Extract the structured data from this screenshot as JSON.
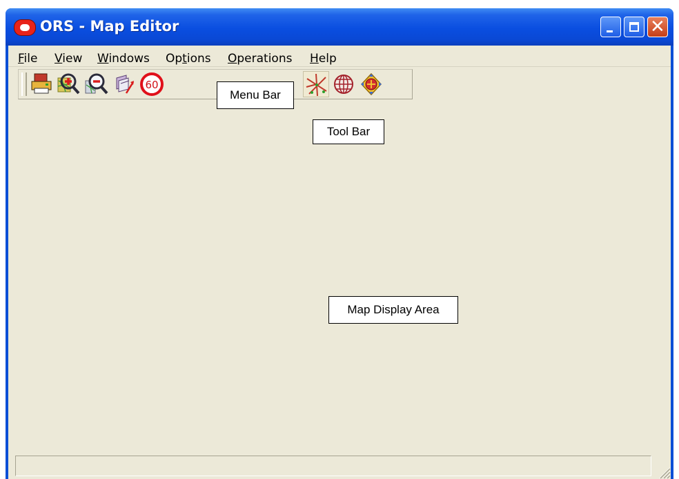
{
  "window": {
    "title": "ORS - Map Editor",
    "title_bar_color": "#0a4ee0",
    "client_color": "#ece9d8"
  },
  "titlebar_controls": [
    {
      "name": "minimize",
      "icon": "minimize-icon"
    },
    {
      "name": "maximize",
      "icon": "maximize-icon"
    },
    {
      "name": "close",
      "icon": "close-icon",
      "glyph": "✕"
    }
  ],
  "menubar": {
    "items": [
      {
        "mnemonic": "F",
        "rest": "ile"
      },
      {
        "mnemonic": "V",
        "rest": "iew"
      },
      {
        "mnemonic": "W",
        "rest": "indows"
      },
      {
        "pre": "Op",
        "mnemonic": "t",
        "rest": "ions"
      },
      {
        "mnemonic": "O",
        "rest": "perations"
      },
      {
        "mnemonic": "H",
        "rest": "elp"
      }
    ]
  },
  "toolbar": {
    "buttons": [
      {
        "icon": "print-icon"
      },
      {
        "icon": "zoom-in-icon"
      },
      {
        "icon": "zoom-out-icon"
      },
      {
        "icon": "layers-icon"
      },
      {
        "icon": "speed-limit-icon",
        "label": "60"
      },
      {
        "icon": "network-tool-icon",
        "active": true
      },
      {
        "icon": "globe-icon"
      },
      {
        "icon": "navigate-icon"
      }
    ]
  },
  "annotations": {
    "menu_bar": "Menu Bar",
    "tool_bar": "Tool Bar",
    "map_display_area": "Map Display Area"
  },
  "statusbar": {
    "text": ""
  }
}
